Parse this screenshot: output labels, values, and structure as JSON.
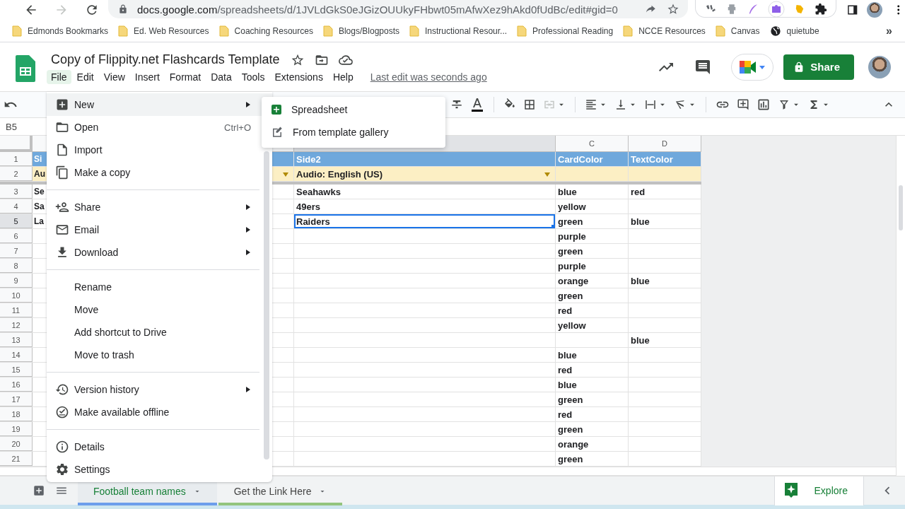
{
  "browser": {
    "forward_disabled": true,
    "url": {
      "domain": "docs.google.com",
      "path": "/spreadsheets/d/1JVLdGkS0eJGizOUUkyFHbwt05mAfwXez9hAkd0fUdBc/edit#gid=0"
    },
    "bookmarks": [
      {
        "label": "Edmonds Bookmarks",
        "kind": "folder"
      },
      {
        "label": "Ed. Web Resources",
        "kind": "folder"
      },
      {
        "label": "Coaching Resources",
        "kind": "folder"
      },
      {
        "label": "Blogs/Blogposts",
        "kind": "folder"
      },
      {
        "label": "Instructional Resour...",
        "kind": "folder"
      },
      {
        "label": "Professional Reading",
        "kind": "folder"
      },
      {
        "label": "NCCE Resources",
        "kind": "folder"
      },
      {
        "label": "Canvas",
        "kind": "folder"
      },
      {
        "label": "quietube",
        "kind": "site"
      }
    ],
    "more": "»"
  },
  "doc": {
    "title": "Copy of Flippity.net Flashcards Template",
    "menus": [
      {
        "label": "File",
        "selected": true
      },
      {
        "label": "Edit",
        "selected": false
      },
      {
        "label": "View",
        "selected": false
      },
      {
        "label": "Insert",
        "selected": false
      },
      {
        "label": "Format",
        "selected": false
      },
      {
        "label": "Data",
        "selected": false
      },
      {
        "label": "Tools",
        "selected": false
      },
      {
        "label": "Extensions",
        "selected": false
      },
      {
        "label": "Help",
        "selected": false
      }
    ],
    "last_edit": "Last edit was seconds ago",
    "share": "Share"
  },
  "toolbar": {
    "merge_disabled": true
  },
  "name_box": "B5",
  "grid": {
    "columns": [
      {
        "selected": false
      },
      {
        "selected": true
      },
      {
        "letter": "C",
        "selected": false
      },
      {
        "letter": "D",
        "selected": false
      }
    ],
    "rows": [
      {
        "number": "1",
        "kind": "header",
        "selected": false,
        "cells": [
          "Si",
          "Side2",
          "CardColor",
          "TextColor"
        ]
      },
      {
        "number": "2",
        "kind": "setting",
        "selected": false,
        "cells": [
          "Au",
          "Audio: English (US)",
          null,
          null
        ]
      },
      {
        "number": "3",
        "kind": "data",
        "selected": false,
        "cells": [
          "Se",
          "Seahawks",
          "blue",
          "red"
        ]
      },
      {
        "number": "4",
        "kind": "data",
        "selected": false,
        "cells": [
          "Sa",
          "49ers",
          "yellow",
          null
        ]
      },
      {
        "number": "5",
        "kind": "data",
        "selected": true,
        "cells": [
          "La",
          "Raiders",
          "green",
          "blue"
        ]
      },
      {
        "number": "6",
        "kind": "data",
        "selected": false,
        "cells": [
          null,
          null,
          "purple",
          null
        ]
      },
      {
        "number": "7",
        "kind": "data",
        "selected": false,
        "cells": [
          null,
          null,
          "green",
          null
        ]
      },
      {
        "number": "8",
        "kind": "data",
        "selected": false,
        "cells": [
          null,
          null,
          "purple",
          null
        ]
      },
      {
        "number": "9",
        "kind": "data",
        "selected": false,
        "cells": [
          null,
          null,
          "orange",
          "blue"
        ]
      },
      {
        "number": "10",
        "kind": "data",
        "selected": false,
        "cells": [
          null,
          null,
          "green",
          null
        ]
      },
      {
        "number": "11",
        "kind": "data",
        "selected": false,
        "cells": [
          null,
          null,
          "red",
          null
        ]
      },
      {
        "number": "12",
        "kind": "data",
        "selected": false,
        "cells": [
          null,
          null,
          "yellow",
          null
        ]
      },
      {
        "number": "13",
        "kind": "data",
        "selected": false,
        "cells": [
          null,
          null,
          null,
          "blue"
        ]
      },
      {
        "number": "14",
        "kind": "data",
        "selected": false,
        "cells": [
          null,
          null,
          "blue",
          null
        ]
      },
      {
        "number": "15",
        "kind": "data",
        "selected": false,
        "cells": [
          null,
          null,
          "red",
          null
        ]
      },
      {
        "number": "16",
        "kind": "data",
        "selected": false,
        "cells": [
          null,
          null,
          "blue",
          null
        ]
      },
      {
        "number": "17",
        "kind": "data",
        "selected": false,
        "cells": [
          null,
          null,
          "green",
          null
        ]
      },
      {
        "number": "18",
        "kind": "data",
        "selected": false,
        "cells": [
          null,
          null,
          "red",
          null
        ]
      },
      {
        "number": "19",
        "kind": "data",
        "selected": false,
        "cells": [
          null,
          null,
          "green",
          null
        ]
      },
      {
        "number": "20",
        "kind": "data",
        "selected": false,
        "cells": [
          null,
          null,
          "orange",
          null
        ]
      },
      {
        "number": "21",
        "kind": "data",
        "selected": false,
        "cells": [
          null,
          null,
          "green",
          null
        ]
      }
    ]
  },
  "file_menu": {
    "groups": [
      [
        {
          "label": "New",
          "submenu": true,
          "selected": true
        },
        {
          "label": "Open",
          "shortcut": "Ctrl+O",
          "submenu": false,
          "selected": false
        },
        {
          "label": "Import",
          "submenu": false,
          "selected": false
        },
        {
          "label": "Make a copy",
          "submenu": false,
          "selected": false
        }
      ],
      [
        {
          "label": "Share",
          "submenu": true,
          "selected": false
        },
        {
          "label": "Email",
          "submenu": true,
          "selected": false
        },
        {
          "label": "Download",
          "submenu": true,
          "selected": false
        }
      ],
      [
        {
          "label": "Rename",
          "submenu": false,
          "selected": false
        },
        {
          "label": "Move",
          "submenu": false,
          "selected": false
        },
        {
          "label": "Add shortcut to Drive",
          "submenu": false,
          "selected": false
        },
        {
          "label": "Move to trash",
          "submenu": false,
          "selected": false
        }
      ],
      [
        {
          "label": "Version history",
          "submenu": true,
          "selected": false
        },
        {
          "label": "Make available offline",
          "submenu": false,
          "selected": false
        }
      ],
      [
        {
          "label": "Details",
          "submenu": false,
          "selected": false
        },
        {
          "label": "Settings",
          "submenu": false,
          "selected": false
        }
      ]
    ]
  },
  "new_submenu": [
    "Spreadsheet",
    "From template gallery"
  ],
  "sheet_tabs": [
    {
      "label": "Football team names",
      "selected": true,
      "color": "#6d9eeb"
    },
    {
      "label": "Get the Link Here",
      "selected": false,
      "color": "#93c47d"
    }
  ],
  "explore": "Explore"
}
